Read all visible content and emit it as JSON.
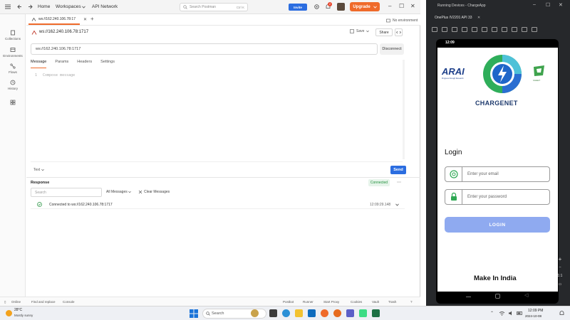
{
  "postman": {
    "nav": {
      "home": "Home",
      "workspaces": "Workspaces",
      "api_network": "API Network"
    },
    "search_placeholder": "Search Postman",
    "search_shortcut": "Ctrl K",
    "invite_label": "Invite",
    "notif_count": "2",
    "upgrade_label": "Upgrade",
    "sidebar": [
      {
        "label": "Collections"
      },
      {
        "label": "Environments"
      },
      {
        "label": "Flows"
      },
      {
        "label": "History"
      }
    ],
    "tab_label": "ws://162.240.106.78:17",
    "environment": "No environment",
    "request_title": "ws://162.240.106.78:1717",
    "save_label": "Save",
    "share_label": "Share",
    "url_value": "ws://162.240.106.78:1717",
    "disconnect_label": "Disconnect",
    "request_tabs": [
      "Message",
      "Params",
      "Headers",
      "Settings"
    ],
    "editor_line": "1",
    "compose_placeholder": "Compose message",
    "format_select": "Text",
    "send_label": "Send",
    "response_title": "Response",
    "connection_status": "Connected",
    "message_search_placeholder": "Search",
    "message_filter": "All Messages",
    "clear_label": "Clear Messages",
    "messages": [
      {
        "text": "Connected to ws://162.240.106.78:1717",
        "time": "12:09:29.148"
      }
    ],
    "statusbar": {
      "online": "Online",
      "find_replace": "Find and replace",
      "console": "Console",
      "postbot": "Postbot",
      "runner": "Runner",
      "proxy": "Start Proxy",
      "cookies": "Cookies",
      "vault": "Vault",
      "trash": "Trash"
    }
  },
  "emulator": {
    "window_title": "Running Devices - ChargeApp",
    "device_name": "OnePlus IV2201 API 33",
    "phone_time": "12:09",
    "brand_left": "ARAI",
    "brand_left_sub": "Progress through Research",
    "brand_right": "CHEET",
    "app_name": "CHARGENET",
    "login_heading": "Login",
    "email_placeholder": "Enter your email",
    "password_placeholder": "Enter your password",
    "login_button": "LOGIN",
    "footer": "Make In India",
    "side_zoom": "1:1"
  },
  "taskbar": {
    "temperature": "28°C",
    "weather": "Mostly sunny",
    "search_label": "Search",
    "time": "12:09 PM",
    "date": "2024-10-08"
  },
  "colors": {
    "accent_orange": "#ef6a2a",
    "accent_blue": "#2b6de0",
    "connected_green": "#1f8f3a",
    "login_button": "#8faaf0"
  }
}
